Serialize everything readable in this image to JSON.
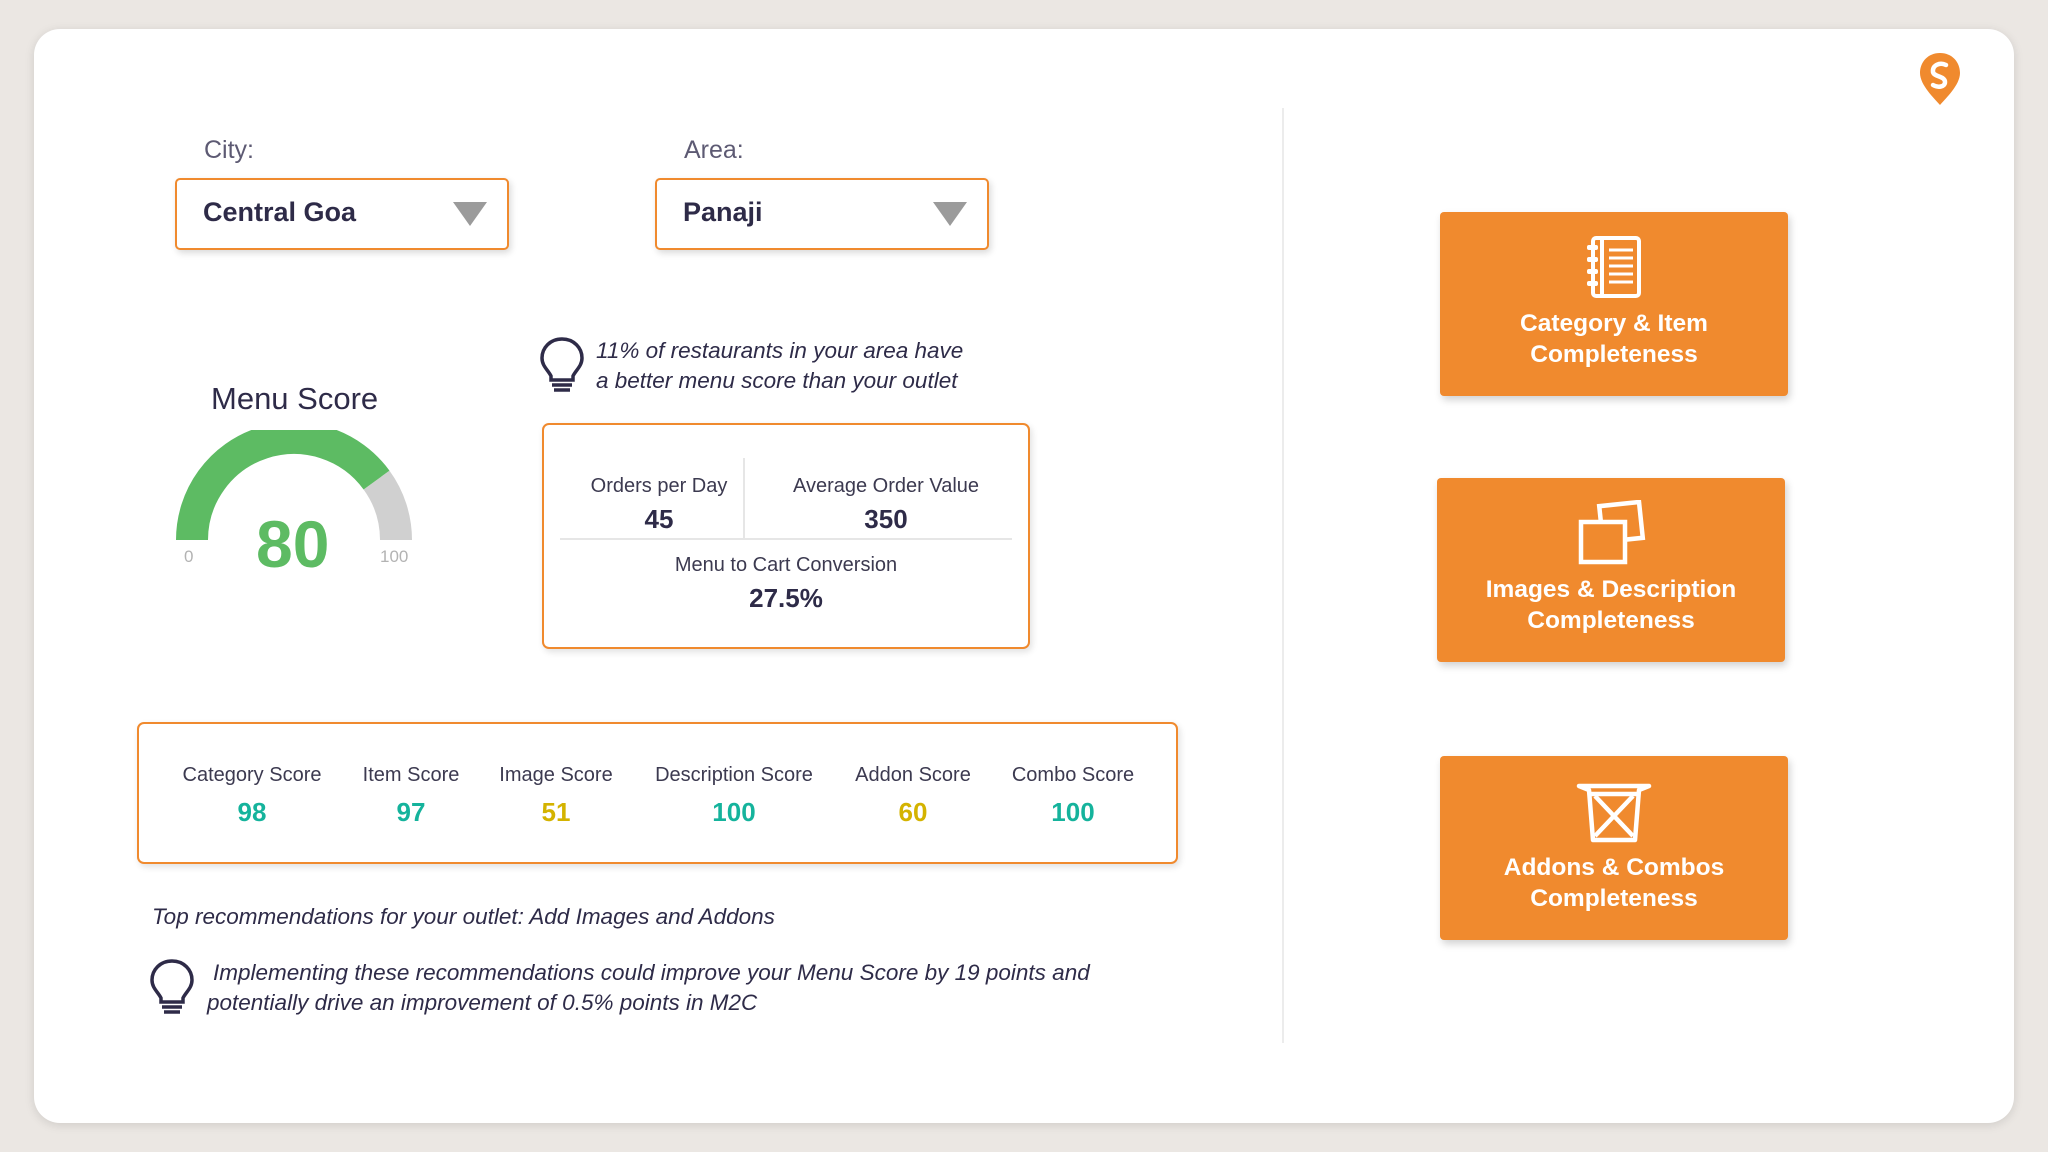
{
  "filters": {
    "city": {
      "label": "City:",
      "value": "Central Goa"
    },
    "area": {
      "label": "Area:",
      "value": "Panaji"
    }
  },
  "menu_score": {
    "title": "Menu Score",
    "value": 80,
    "min": "0",
    "max": "100",
    "fill_fraction": 0.8
  },
  "tip_top": {
    "line1": "11% of restaurants in your area have",
    "line2": "a better menu score than your outlet"
  },
  "metrics": {
    "orders_per_day": {
      "label": "Orders per Day",
      "value": "45"
    },
    "avg_order_value": {
      "label": "Average Order Value",
      "value": "350"
    },
    "m2c": {
      "label": "Menu to Cart Conversion",
      "value": "27.5%"
    }
  },
  "scores": [
    {
      "label": "Category Score",
      "value": "98",
      "color": "#15b39c"
    },
    {
      "label": "Item Score",
      "value": "97",
      "color": "#15b39c"
    },
    {
      "label": "Image Score",
      "value": "51",
      "color": "#d4b300"
    },
    {
      "label": "Description Score",
      "value": "100",
      "color": "#15b39c"
    },
    {
      "label": "Addon Score",
      "value": "60",
      "color": "#d4b300"
    },
    {
      "label": "Combo Score",
      "value": "100",
      "color": "#15b39c"
    }
  ],
  "recommendation": {
    "title": "Top recommendations for your outlet: Add Images and Addons",
    "line1": "Implementing these recommendations could improve your Menu Score by 19 points and",
    "line2": "potentially drive an improvement of 0.5% points in M2C"
  },
  "tiles": [
    {
      "line1": "Category & Item",
      "line2": "Completeness",
      "icon": "notebook-icon"
    },
    {
      "line1": "Images & Description",
      "line2": "Completeness",
      "icon": "images-icon"
    },
    {
      "line1": "Addons & Combos",
      "line2": "Completeness",
      "icon": "basket-icon"
    }
  ],
  "colors": {
    "accent": "#f08a2e",
    "gauge_fill": "#5dbb63",
    "gauge_rest": "#d0d0d0",
    "text": "#2e2b48"
  }
}
